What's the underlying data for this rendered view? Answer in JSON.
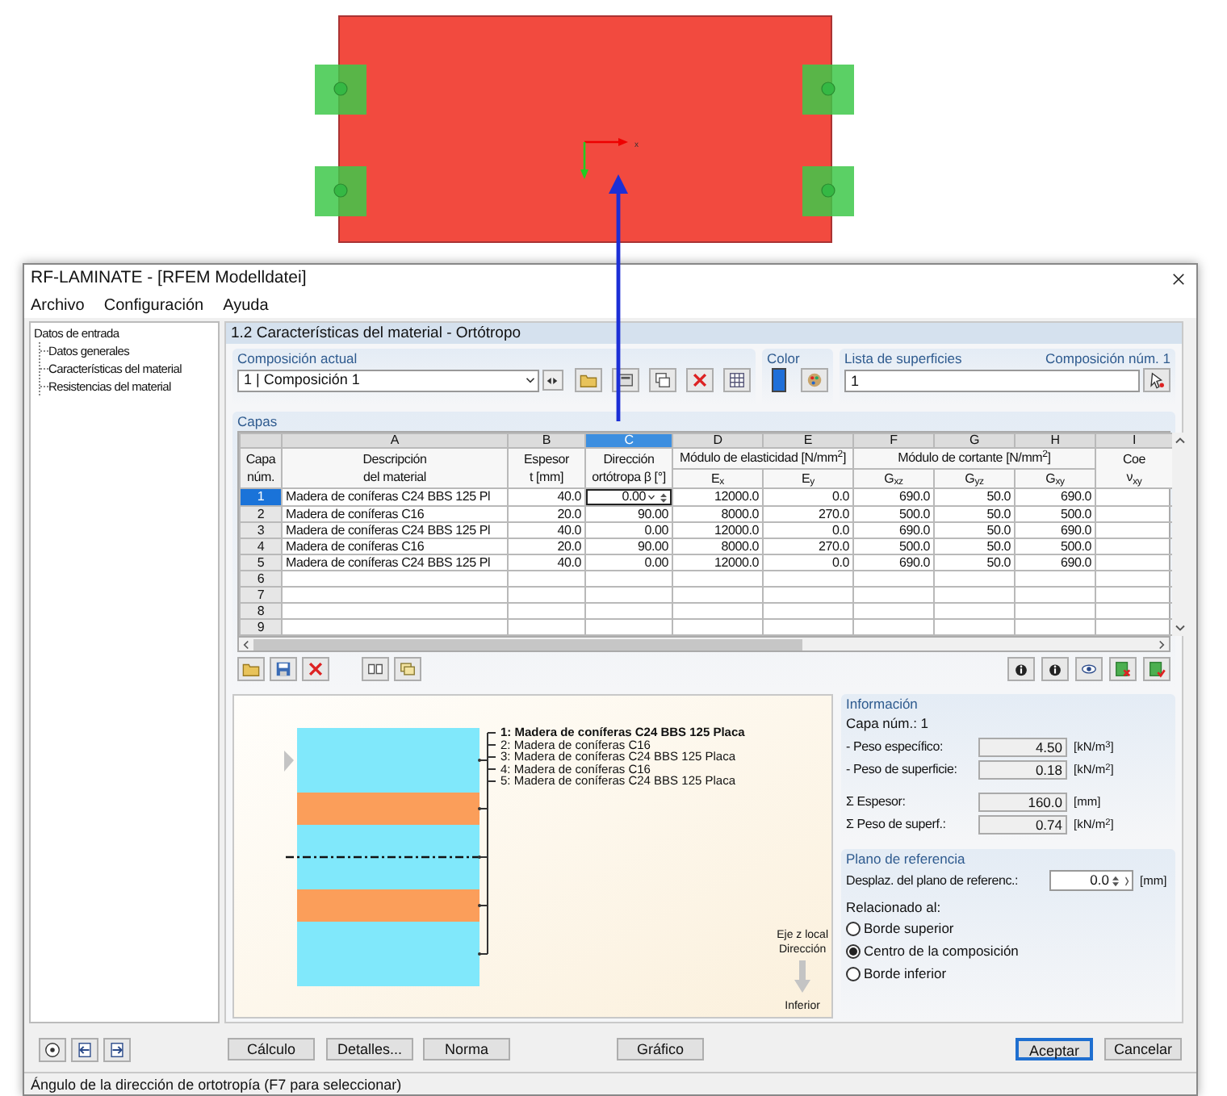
{
  "model": {
    "axis_label": "x"
  },
  "window": {
    "title": "RF-LAMINATE - [RFEM Modelldatei]"
  },
  "menu": [
    "Archivo",
    "Configuración",
    "Ayuda"
  ],
  "navigator": {
    "label": "Datos de entrada",
    "children": [
      {
        "label": "Datos generales"
      },
      {
        "label": "Características del material"
      },
      {
        "label": "Resistencias del material"
      }
    ]
  },
  "section_title": "1.2 Características del material - Ortótropo",
  "composition": {
    "label": "Composición actual",
    "value": "1 | Composición 1"
  },
  "color": {
    "label": "Color"
  },
  "surfaces": {
    "label": "Lista de superficies",
    "value": "1",
    "composition_number": "Composición núm. 1"
  },
  "layers_table": {
    "title": "Capas",
    "number_heading": [
      "Capa",
      "núm."
    ],
    "columns": [
      {
        "kind": "single",
        "letter": "A",
        "selected": false,
        "heading": [
          "Descripción",
          "del material"
        ]
      },
      {
        "kind": "single",
        "letter": "B",
        "selected": false,
        "heading": [
          "Espesor",
          "t [mm]"
        ]
      },
      {
        "kind": "single",
        "letter": "C",
        "selected": true,
        "heading": [
          "Dirección",
          "ortótropa β [°]"
        ]
      },
      {
        "kind": "group_start",
        "group_label": "Módulo de elasticidad [N/mm$^{2}$]",
        "letter": "D",
        "selected": false,
        "heading": [
          "E$_{x}$"
        ]
      },
      {
        "kind": "group_member",
        "letter": "E",
        "selected": false,
        "heading": [
          "E$_{y}$"
        ]
      },
      {
        "kind": "group_start",
        "group_label": "Módulo de cortante [N/mm$^{2}$]",
        "letter": "F",
        "selected": false,
        "heading": [
          "G$_{xz}$"
        ]
      },
      {
        "kind": "group_member",
        "letter": "G",
        "selected": false,
        "heading": [
          "G$_{yz}$"
        ]
      },
      {
        "kind": "group_member",
        "letter": "H",
        "selected": false,
        "heading": [
          "G$_{xy}$"
        ]
      },
      {
        "kind": "single",
        "letter": "I",
        "selected": false,
        "heading": [
          "Coe",
          "ν$_{xy}$"
        ]
      }
    ],
    "rows": [
      {
        "number": "1",
        "selected": true,
        "cells": [
          "Madera de coníferas C24 BBS 125 Pl",
          "40.0",
          "0.00",
          "12000.0",
          "0.0",
          "690.0",
          "50.0",
          "690.0"
        ]
      },
      {
        "number": "2",
        "selected": false,
        "cells": [
          "Madera de coníferas C16",
          "20.0",
          "90.00",
          "8000.0",
          "270.0",
          "500.0",
          "50.0",
          "500.0"
        ]
      },
      {
        "number": "3",
        "selected": false,
        "cells": [
          "Madera de coníferas C24 BBS 125 Pl",
          "40.0",
          "0.00",
          "12000.0",
          "0.0",
          "690.0",
          "50.0",
          "690.0"
        ]
      },
      {
        "number": "4",
        "selected": false,
        "cells": [
          "Madera de coníferas C16",
          "20.0",
          "90.00",
          "8000.0",
          "270.0",
          "500.0",
          "50.0",
          "500.0"
        ]
      },
      {
        "number": "5",
        "selected": false,
        "cells": [
          "Madera de coníferas C24 BBS 125 Pl",
          "40.0",
          "0.00",
          "12000.0",
          "0.0",
          "690.0",
          "50.0",
          "690.0"
        ]
      },
      {
        "number": "6",
        "selected": false,
        "cells": []
      },
      {
        "number": "7",
        "selected": false,
        "cells": []
      },
      {
        "number": "8",
        "selected": false,
        "cells": []
      },
      {
        "number": "9",
        "selected": false,
        "cells": []
      }
    ]
  },
  "diagram": {
    "layers": [
      {
        "label": "1: Madera de coníferas C24 BBS 125 Placa",
        "selected": true,
        "color": "#80e8fb"
      },
      {
        "label": "2: Madera de coníferas C16",
        "selected": false,
        "color": "#fb9e5a"
      },
      {
        "label": "3: Madera de coníferas C24 BBS 125 Placa",
        "selected": false,
        "color": "#80e8fb"
      },
      {
        "label": "4: Madera de coníferas C16",
        "selected": false,
        "color": "#fb9e5a"
      },
      {
        "label": "5: Madera de coníferas C24 BBS 125 Placa",
        "selected": false,
        "color": "#80e8fb"
      }
    ],
    "axis": {
      "lines": [
        "Eje z local",
        "Dirección"
      ],
      "end": "Inferior"
    }
  },
  "info": {
    "title": "Información",
    "layer": "Capa núm.: 1",
    "fields": [
      {
        "label": "- Peso específico:",
        "value": "4.50",
        "unit": "[kN/m$^{3}$]"
      },
      {
        "label": "- Peso de superficie:",
        "value": "0.18",
        "unit": "[kN/m$^{2}$]"
      },
      {
        "label": "Σ Espesor:",
        "value": "160.0",
        "unit": "[mm]"
      },
      {
        "label": "Σ Peso de superf.:",
        "value": "0.74",
        "unit": "[kN/m$^{2}$]"
      }
    ]
  },
  "reference": {
    "title": "Plano de referencia",
    "offset_label": "Desplaz. del plano de referenc.:",
    "offset_value": "0.0",
    "offset_unit": "[mm]",
    "related_label": "Relacionado al:",
    "options": [
      {
        "label": "Borde superior",
        "selected": false
      },
      {
        "label": "Centro de la composición",
        "selected": true
      },
      {
        "label": "Borde inferior",
        "selected": false
      }
    ]
  },
  "buttons": [
    {
      "label": "Cálculo"
    },
    {
      "label": "Detalles..."
    },
    {
      "label": "Norma"
    },
    {
      "label": "Gráfico"
    }
  ],
  "dialog_buttons": [
    {
      "label": "Aceptar",
      "default": true
    },
    {
      "label": "Cancelar",
      "default": false
    }
  ],
  "status_bar": "Ángulo de la dirección de ortotropía (F7 para seleccionar)"
}
